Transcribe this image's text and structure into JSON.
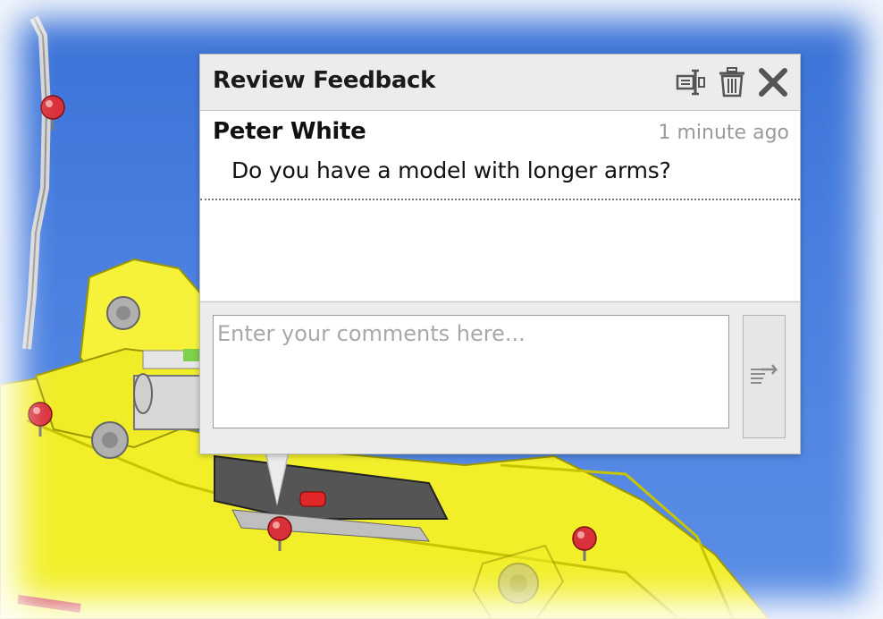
{
  "panel": {
    "title": "Review Feedback",
    "icons": {
      "pin": "pin-icon",
      "delete": "trash-icon",
      "close": "close-icon"
    }
  },
  "comments": [
    {
      "author": "Peter White",
      "time": "1 minute ago",
      "text": "Do you have a model with longer arms?"
    }
  ],
  "input": {
    "placeholder": "Enter your comments here...",
    "value": ""
  },
  "send": {
    "icon": "send-icon"
  },
  "viewport": {
    "background_color": "#4a7fe0",
    "model_color": "#ffff33",
    "marker_color": "#d9303a",
    "markers": [
      "marker",
      "marker",
      "marker",
      "marker"
    ]
  }
}
